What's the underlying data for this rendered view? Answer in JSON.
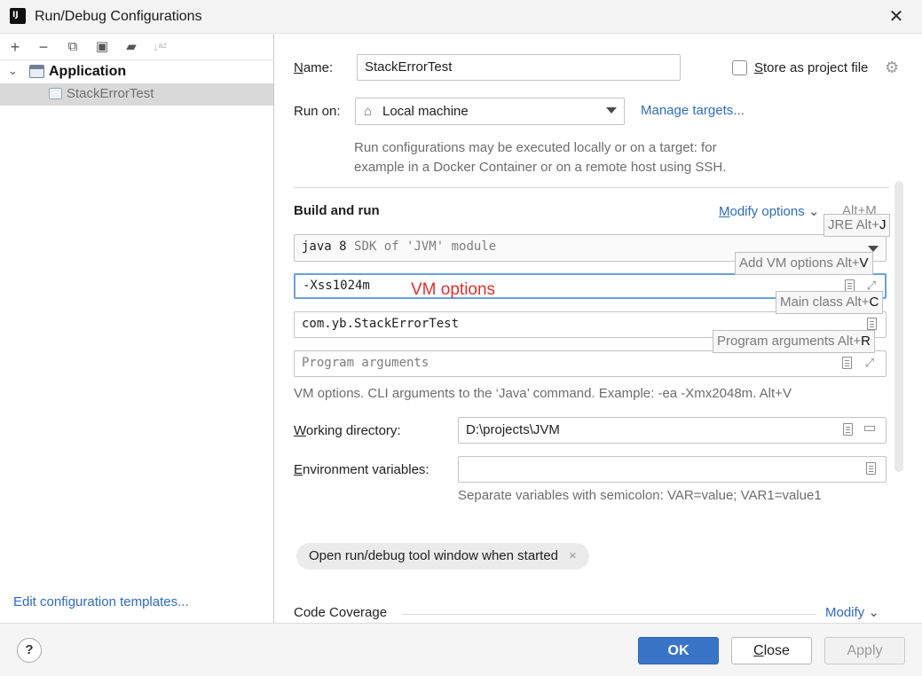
{
  "window": {
    "title": "Run/Debug Configurations",
    "close_symbol": "✕"
  },
  "toolbar": {
    "add": "+",
    "remove": "−",
    "copy": "⧉",
    "save": "▣",
    "folder": "▰",
    "sort": "↓ᵃᶻ"
  },
  "tree": {
    "group_label": "Application",
    "item_label": "StackErrorTest"
  },
  "left_footer": {
    "edit_templates": "Edit configuration templates..."
  },
  "form": {
    "name_label_u": "N",
    "name_label_rest": "ame:",
    "name_value": "StackErrorTest",
    "store_label_u": "S",
    "store_label_rest": "tore as project file",
    "run_on_label": "Run on:",
    "run_on_value": "Local machine",
    "manage_targets": "Manage targets...",
    "run_on_hint_1": "Run configurations may be executed locally or on a target: for",
    "run_on_hint_2": "example in a Docker Container or on a remote host using SSH."
  },
  "build_run": {
    "title": "Build and run",
    "modify_u": "M",
    "modify_rest": "odify options",
    "modify_shortcut": "Alt+M",
    "jre_value_main": "java 8",
    "jre_value_sub": "SDK of 'JVM' module",
    "vm_value": "-Xss1024m",
    "vm_annotation": "VM options",
    "main_class_value": "com.yb.StackErrorTest",
    "program_args_placeholder": "Program arguments",
    "vm_hint": "VM options. CLI arguments to the ‘Java’ command. Example: -ea -Xmx2048m. Alt+V"
  },
  "tooltips": {
    "jre_text": "JRE Alt+",
    "jre_key": "J",
    "vm_text": "Add VM options Alt+",
    "vm_key": "V",
    "main_text": "Main class Alt+",
    "main_key": "C",
    "args_text": "Program arguments Alt+",
    "args_key": "R"
  },
  "working_dir": {
    "label_u": "W",
    "label_rest": "orking directory:",
    "value": "D:\\projects\\JVM"
  },
  "env_vars": {
    "label_u": "E",
    "label_rest": "nvironment variables:",
    "value": "",
    "hint": "Separate variables with semicolon: VAR=value; VAR1=value1"
  },
  "chip": {
    "label": "Open run/debug tool window when started",
    "remove": "×"
  },
  "code_coverage": {
    "label": "Code Coverage",
    "modify": "Modify"
  },
  "buttons": {
    "help": "?",
    "ok": "OK",
    "close_u": "C",
    "close_rest": "lose",
    "apply": "Apply"
  },
  "colors": {
    "accent": "#3974c7",
    "link": "#2f6bbf",
    "annotation": "#e0312d"
  }
}
